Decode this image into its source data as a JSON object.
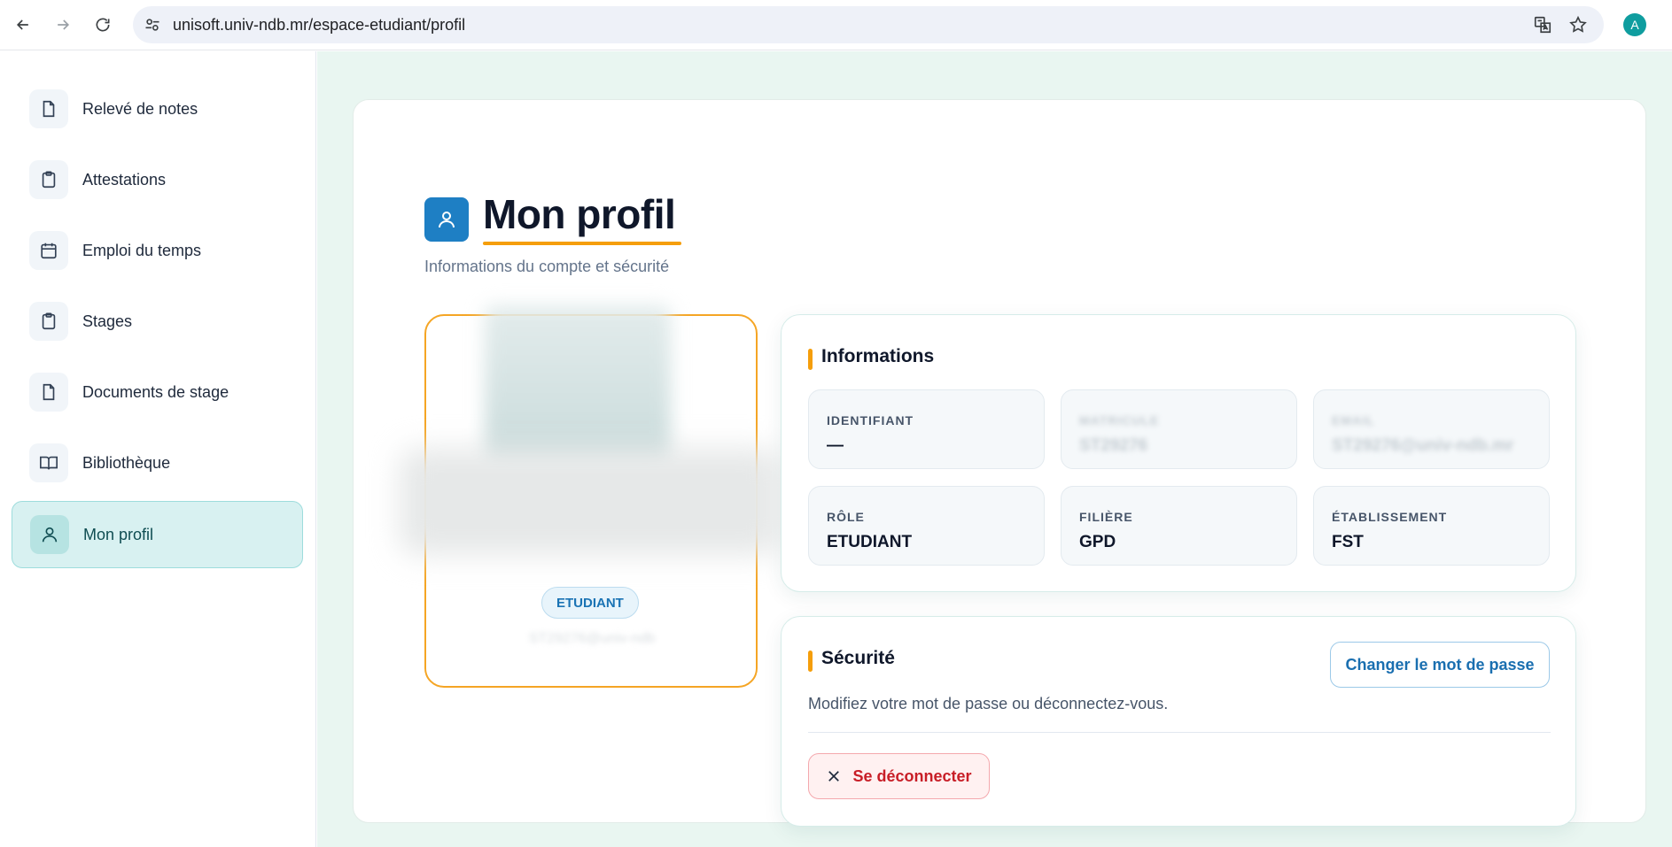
{
  "browser": {
    "url": "unisoft.univ-ndb.mr/espace-etudiant/profil",
    "profile_initial": "A"
  },
  "sidebar": {
    "items": [
      {
        "label": "Relevé de notes",
        "icon": "document-icon"
      },
      {
        "label": "Attestations",
        "icon": "clipboard-icon"
      },
      {
        "label": "Emploi du temps",
        "icon": "calendar-icon"
      },
      {
        "label": "Stages",
        "icon": "clipboard-icon"
      },
      {
        "label": "Documents de stage",
        "icon": "document-icon"
      },
      {
        "label": "Bibliothèque",
        "icon": "book-icon"
      },
      {
        "label": "Mon profil",
        "icon": "user-icon",
        "active": true
      }
    ]
  },
  "header": {
    "title": "Mon profil",
    "subtitle": "Informations du compte et sécurité"
  },
  "profile_card": {
    "role_badge": "ETUDIANT",
    "matricule_blurred": "ST29276@univ-ndb"
  },
  "info": {
    "title": "Informations",
    "fields": [
      {
        "label": "IDENTIFIANT",
        "value": "—"
      },
      {
        "label": "MATRICULE",
        "value": "ST29276"
      },
      {
        "label": "EMAIL",
        "value": "ST29276@univ-ndb.mr"
      },
      {
        "label": "RÔLE",
        "value": "ETUDIANT"
      },
      {
        "label": "FILIÈRE",
        "value": "GPD"
      },
      {
        "label": "ÉTABLISSEMENT",
        "value": "FST"
      }
    ]
  },
  "security": {
    "title": "Sécurité",
    "description": "Modifiez votre mot de passe ou déconnectez-vous.",
    "change_password_label": "Changer le mot de passe",
    "logout_label": "Se déconnecter"
  },
  "colors": {
    "accent_orange": "#f59e0b",
    "primary_blue": "#1e7fc4",
    "active_teal": "#d8f1f1",
    "danger_red": "#c81e27"
  }
}
